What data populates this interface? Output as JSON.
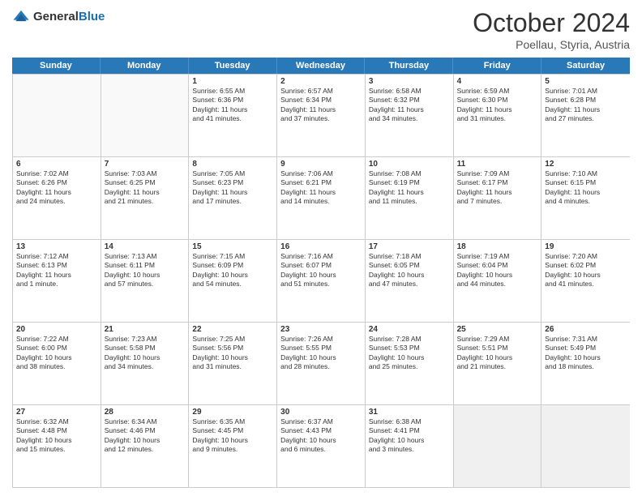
{
  "header": {
    "logo": {
      "general": "General",
      "blue": "Blue"
    },
    "title": "October 2024",
    "location": "Poellau, Styria, Austria"
  },
  "weekdays": [
    "Sunday",
    "Monday",
    "Tuesday",
    "Wednesday",
    "Thursday",
    "Friday",
    "Saturday"
  ],
  "rows": [
    [
      {
        "day": "",
        "lines": []
      },
      {
        "day": "",
        "lines": []
      },
      {
        "day": "1",
        "lines": [
          "Sunrise: 6:55 AM",
          "Sunset: 6:36 PM",
          "Daylight: 11 hours",
          "and 41 minutes."
        ]
      },
      {
        "day": "2",
        "lines": [
          "Sunrise: 6:57 AM",
          "Sunset: 6:34 PM",
          "Daylight: 11 hours",
          "and 37 minutes."
        ]
      },
      {
        "day": "3",
        "lines": [
          "Sunrise: 6:58 AM",
          "Sunset: 6:32 PM",
          "Daylight: 11 hours",
          "and 34 minutes."
        ]
      },
      {
        "day": "4",
        "lines": [
          "Sunrise: 6:59 AM",
          "Sunset: 6:30 PM",
          "Daylight: 11 hours",
          "and 31 minutes."
        ]
      },
      {
        "day": "5",
        "lines": [
          "Sunrise: 7:01 AM",
          "Sunset: 6:28 PM",
          "Daylight: 11 hours",
          "and 27 minutes."
        ]
      }
    ],
    [
      {
        "day": "6",
        "lines": [
          "Sunrise: 7:02 AM",
          "Sunset: 6:26 PM",
          "Daylight: 11 hours",
          "and 24 minutes."
        ]
      },
      {
        "day": "7",
        "lines": [
          "Sunrise: 7:03 AM",
          "Sunset: 6:25 PM",
          "Daylight: 11 hours",
          "and 21 minutes."
        ]
      },
      {
        "day": "8",
        "lines": [
          "Sunrise: 7:05 AM",
          "Sunset: 6:23 PM",
          "Daylight: 11 hours",
          "and 17 minutes."
        ]
      },
      {
        "day": "9",
        "lines": [
          "Sunrise: 7:06 AM",
          "Sunset: 6:21 PM",
          "Daylight: 11 hours",
          "and 14 minutes."
        ]
      },
      {
        "day": "10",
        "lines": [
          "Sunrise: 7:08 AM",
          "Sunset: 6:19 PM",
          "Daylight: 11 hours",
          "and 11 minutes."
        ]
      },
      {
        "day": "11",
        "lines": [
          "Sunrise: 7:09 AM",
          "Sunset: 6:17 PM",
          "Daylight: 11 hours",
          "and 7 minutes."
        ]
      },
      {
        "day": "12",
        "lines": [
          "Sunrise: 7:10 AM",
          "Sunset: 6:15 PM",
          "Daylight: 11 hours",
          "and 4 minutes."
        ]
      }
    ],
    [
      {
        "day": "13",
        "lines": [
          "Sunrise: 7:12 AM",
          "Sunset: 6:13 PM",
          "Daylight: 11 hours",
          "and 1 minute."
        ]
      },
      {
        "day": "14",
        "lines": [
          "Sunrise: 7:13 AM",
          "Sunset: 6:11 PM",
          "Daylight: 10 hours",
          "and 57 minutes."
        ]
      },
      {
        "day": "15",
        "lines": [
          "Sunrise: 7:15 AM",
          "Sunset: 6:09 PM",
          "Daylight: 10 hours",
          "and 54 minutes."
        ]
      },
      {
        "day": "16",
        "lines": [
          "Sunrise: 7:16 AM",
          "Sunset: 6:07 PM",
          "Daylight: 10 hours",
          "and 51 minutes."
        ]
      },
      {
        "day": "17",
        "lines": [
          "Sunrise: 7:18 AM",
          "Sunset: 6:05 PM",
          "Daylight: 10 hours",
          "and 47 minutes."
        ]
      },
      {
        "day": "18",
        "lines": [
          "Sunrise: 7:19 AM",
          "Sunset: 6:04 PM",
          "Daylight: 10 hours",
          "and 44 minutes."
        ]
      },
      {
        "day": "19",
        "lines": [
          "Sunrise: 7:20 AM",
          "Sunset: 6:02 PM",
          "Daylight: 10 hours",
          "and 41 minutes."
        ]
      }
    ],
    [
      {
        "day": "20",
        "lines": [
          "Sunrise: 7:22 AM",
          "Sunset: 6:00 PM",
          "Daylight: 10 hours",
          "and 38 minutes."
        ]
      },
      {
        "day": "21",
        "lines": [
          "Sunrise: 7:23 AM",
          "Sunset: 5:58 PM",
          "Daylight: 10 hours",
          "and 34 minutes."
        ]
      },
      {
        "day": "22",
        "lines": [
          "Sunrise: 7:25 AM",
          "Sunset: 5:56 PM",
          "Daylight: 10 hours",
          "and 31 minutes."
        ]
      },
      {
        "day": "23",
        "lines": [
          "Sunrise: 7:26 AM",
          "Sunset: 5:55 PM",
          "Daylight: 10 hours",
          "and 28 minutes."
        ]
      },
      {
        "day": "24",
        "lines": [
          "Sunrise: 7:28 AM",
          "Sunset: 5:53 PM",
          "Daylight: 10 hours",
          "and 25 minutes."
        ]
      },
      {
        "day": "25",
        "lines": [
          "Sunrise: 7:29 AM",
          "Sunset: 5:51 PM",
          "Daylight: 10 hours",
          "and 21 minutes."
        ]
      },
      {
        "day": "26",
        "lines": [
          "Sunrise: 7:31 AM",
          "Sunset: 5:49 PM",
          "Daylight: 10 hours",
          "and 18 minutes."
        ]
      }
    ],
    [
      {
        "day": "27",
        "lines": [
          "Sunrise: 6:32 AM",
          "Sunset: 4:48 PM",
          "Daylight: 10 hours",
          "and 15 minutes."
        ]
      },
      {
        "day": "28",
        "lines": [
          "Sunrise: 6:34 AM",
          "Sunset: 4:46 PM",
          "Daylight: 10 hours",
          "and 12 minutes."
        ]
      },
      {
        "day": "29",
        "lines": [
          "Sunrise: 6:35 AM",
          "Sunset: 4:45 PM",
          "Daylight: 10 hours",
          "and 9 minutes."
        ]
      },
      {
        "day": "30",
        "lines": [
          "Sunrise: 6:37 AM",
          "Sunset: 4:43 PM",
          "Daylight: 10 hours",
          "and 6 minutes."
        ]
      },
      {
        "day": "31",
        "lines": [
          "Sunrise: 6:38 AM",
          "Sunset: 4:41 PM",
          "Daylight: 10 hours",
          "and 3 minutes."
        ]
      },
      {
        "day": "",
        "lines": []
      },
      {
        "day": "",
        "lines": []
      }
    ]
  ]
}
